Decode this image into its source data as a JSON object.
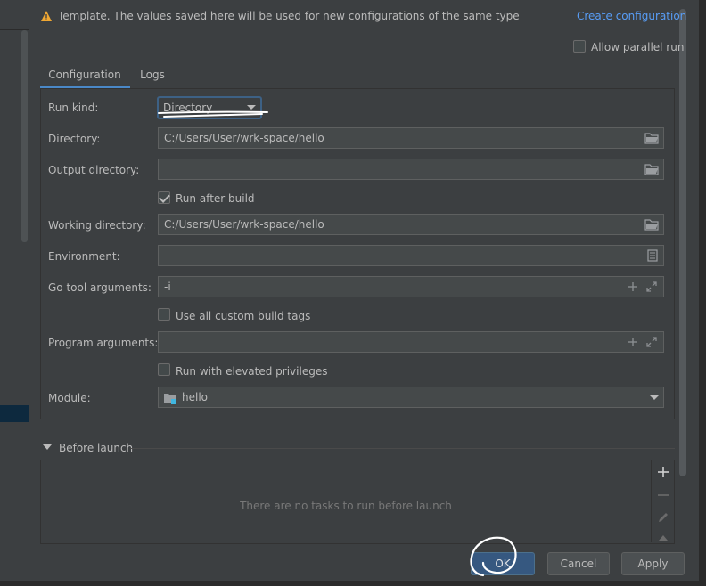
{
  "header": {
    "template_text": "Template. The values saved here will be used for new configurations of the same type",
    "create_configuration": "Create configuration",
    "allow_parallel_run": "Allow parallel run",
    "allow_parallel_checked": false
  },
  "tabs": [
    {
      "label": "Configuration",
      "active": true
    },
    {
      "label": "Logs",
      "active": false
    }
  ],
  "form": {
    "run_kind": {
      "label": "Run kind:",
      "value": "Directory"
    },
    "directory": {
      "label": "Directory:",
      "value": "C:/Users/User/wrk-space/hello"
    },
    "output_directory": {
      "label": "Output directory:",
      "value": ""
    },
    "run_after_build": {
      "label": "Run after build",
      "checked": true
    },
    "working_directory": {
      "label": "Working directory:",
      "value": "C:/Users/User/wrk-space/hello"
    },
    "environment": {
      "label": "Environment:",
      "value": ""
    },
    "go_tool_arguments": {
      "label": "Go tool arguments:",
      "value": "-i"
    },
    "use_all_custom_build_tags": {
      "label": "Use all custom build tags",
      "checked": false
    },
    "program_arguments": {
      "label": "Program arguments:",
      "value": ""
    },
    "run_with_elevated_privileges": {
      "label": "Run with elevated privileges",
      "checked": false
    },
    "module": {
      "label": "Module:",
      "value": "hello"
    }
  },
  "before_launch": {
    "label": "Before launch",
    "empty_text": "There are no tasks to run before launch"
  },
  "buttons": {
    "ok": "OK",
    "cancel": "Cancel",
    "apply": "Apply"
  },
  "colors": {
    "background": "#3c3f41",
    "field": "#45494a",
    "link": "#589df6",
    "accent": "#4a88c7",
    "ok_button": "#365880",
    "annotation": "#ffffff"
  }
}
